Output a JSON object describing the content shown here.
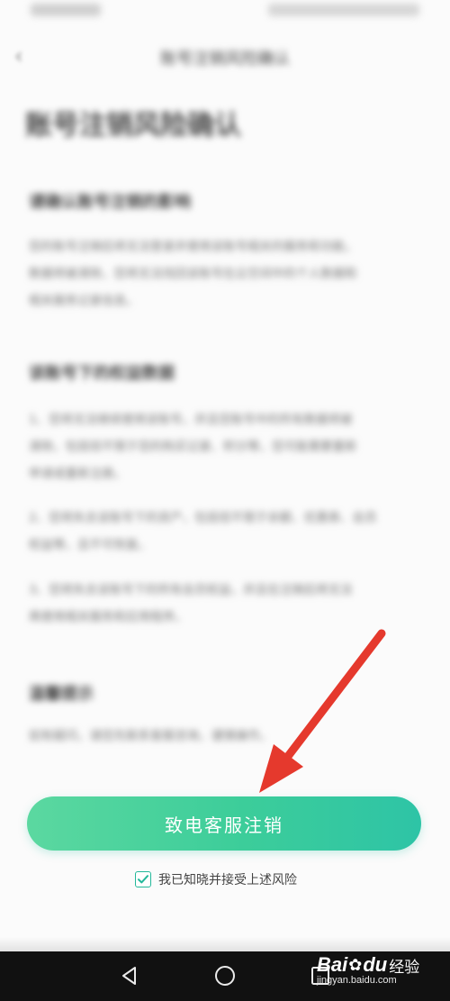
{
  "status_bar": {
    "left_text": "",
    "right_text": ""
  },
  "nav": {
    "title": "账号注销风险确认"
  },
  "page_heading": "账号注销风险确认",
  "sections": [
    {
      "title": "请确认账号注销的影响",
      "paras": [
        "您的账号注销后将无法登录并使用该账号相关的服务和功能，",
        "数据将被清除，您将无法找回该账号在云空间中的个人数据和",
        "相关服务记录信息。"
      ]
    },
    {
      "title": "该账号下的权益数据",
      "paras": [
        "1、您将无法继续使用该账号，并且您账号中的所有数据将被",
        "清除，包括但不限于您的购买记录、积分等，您可能需要重新",
        "申请或重新注册。",
        "2、您将失去该账号下的资产，包括但不限于余额、优惠券、会员",
        "权益等，且不可恢复。",
        "3、您将失去该账号下的所有会员权益，并且在注销后将无法",
        "再使用相关服务和应用程序。"
      ]
    },
    {
      "title": "温馨提示",
      "paras": [
        "如有疑问，请您先联系客服咨询，谨慎操作。"
      ]
    }
  ],
  "cta_button": {
    "label": "致电客服注销"
  },
  "consent": {
    "label": "我已知晓并接受上述风险",
    "checked": true
  },
  "watermark": {
    "brand": "Bai",
    "brand2": "du",
    "product": "经验",
    "url": "jingyan.baidu.com"
  },
  "colors": {
    "accent_start": "#5bd8a0",
    "accent_end": "#2ec4a6",
    "arrow": "#e5392d",
    "checkbox": "#23b89a"
  },
  "icons": [
    "back-icon",
    "checkmark-icon",
    "back-nav-icon",
    "home-nav-icon",
    "recents-nav-icon",
    "baidu-paw-icon",
    "red-pointer-arrow"
  ]
}
